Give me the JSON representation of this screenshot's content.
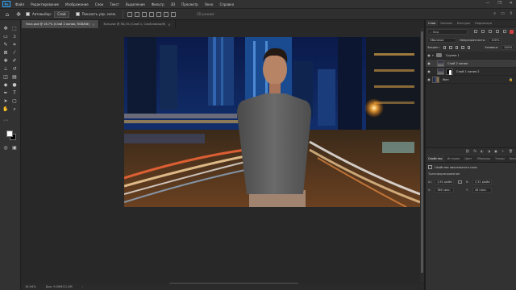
{
  "app": {
    "logo": "Ps",
    "menu": [
      "Файл",
      "Редактирование",
      "Изображение",
      "Слои",
      "Текст",
      "Выделение",
      "Фильтр",
      "3D",
      "Просмотр",
      "Окно",
      "Справка"
    ],
    "window_controls": [
      "—",
      "❐",
      "✕"
    ]
  },
  "options": {
    "autoselect_label": "Автовыбор:",
    "autoselect_value": "Слой",
    "show_controls_label": "Показать упр. элем.",
    "mode_3d_label": "3D-режим:",
    "right_icons": [
      "⌕",
      "▭",
      "⇪"
    ]
  },
  "tabs": [
    {
      "title": "Fona.psd @ 16,7% (Слой 2 копия, RGB/8#)",
      "close": "×",
      "active": true
    },
    {
      "title": "Ksin.psd @ 38,1% (Слой 1, Слой-маска/8)",
      "close": "×",
      "active": false
    }
  ],
  "status": {
    "zoom": "16,94%",
    "doc": "Док: 9,00M/11,3M",
    "arrow": "›"
  },
  "panels": {
    "top_tabs": [
      "Слои",
      "Каналы",
      "Контуры",
      "Коррекция"
    ],
    "search_label": "Вид",
    "blend_mode": "Обычные",
    "opacity_label": "Непрозрачность:",
    "opacity_value": "100%",
    "lock_label": "Закреп.:",
    "fill_label": "Заливка:",
    "fill_value": "100%",
    "footer_icons": [
      "⛓",
      "fx",
      "◐",
      "◑",
      "▣",
      "＋",
      "🗑"
    ]
  },
  "layers": [
    {
      "name": "Группа 1",
      "kind": "group",
      "selected": false
    },
    {
      "name": "Слой 2 копия",
      "kind": "layer",
      "selected": true
    },
    {
      "name": "Слой 1 копия 2",
      "kind": "masked",
      "selected": false
    },
    {
      "name": "Фон",
      "kind": "background",
      "selected": false
    }
  ],
  "properties": {
    "tabs": [
      "Свойства",
      "История",
      "Цвет",
      "Образцы",
      "Узоры",
      "Кисть"
    ],
    "title": "Свойства пиксельного слоя",
    "subtitle": "Трансформирование",
    "w_label": "Ш:",
    "w_value": "1,94 дюйм",
    "h_label": "В:",
    "h_value": "2,31 дюйм",
    "x_label": "X:",
    "x_value": "786 пикс.",
    "y_label": "Y:",
    "y_value": "26 пикс."
  },
  "colors": {
    "foreground": "#ffffff",
    "background": "#000000",
    "accent": "#31a8ff"
  }
}
